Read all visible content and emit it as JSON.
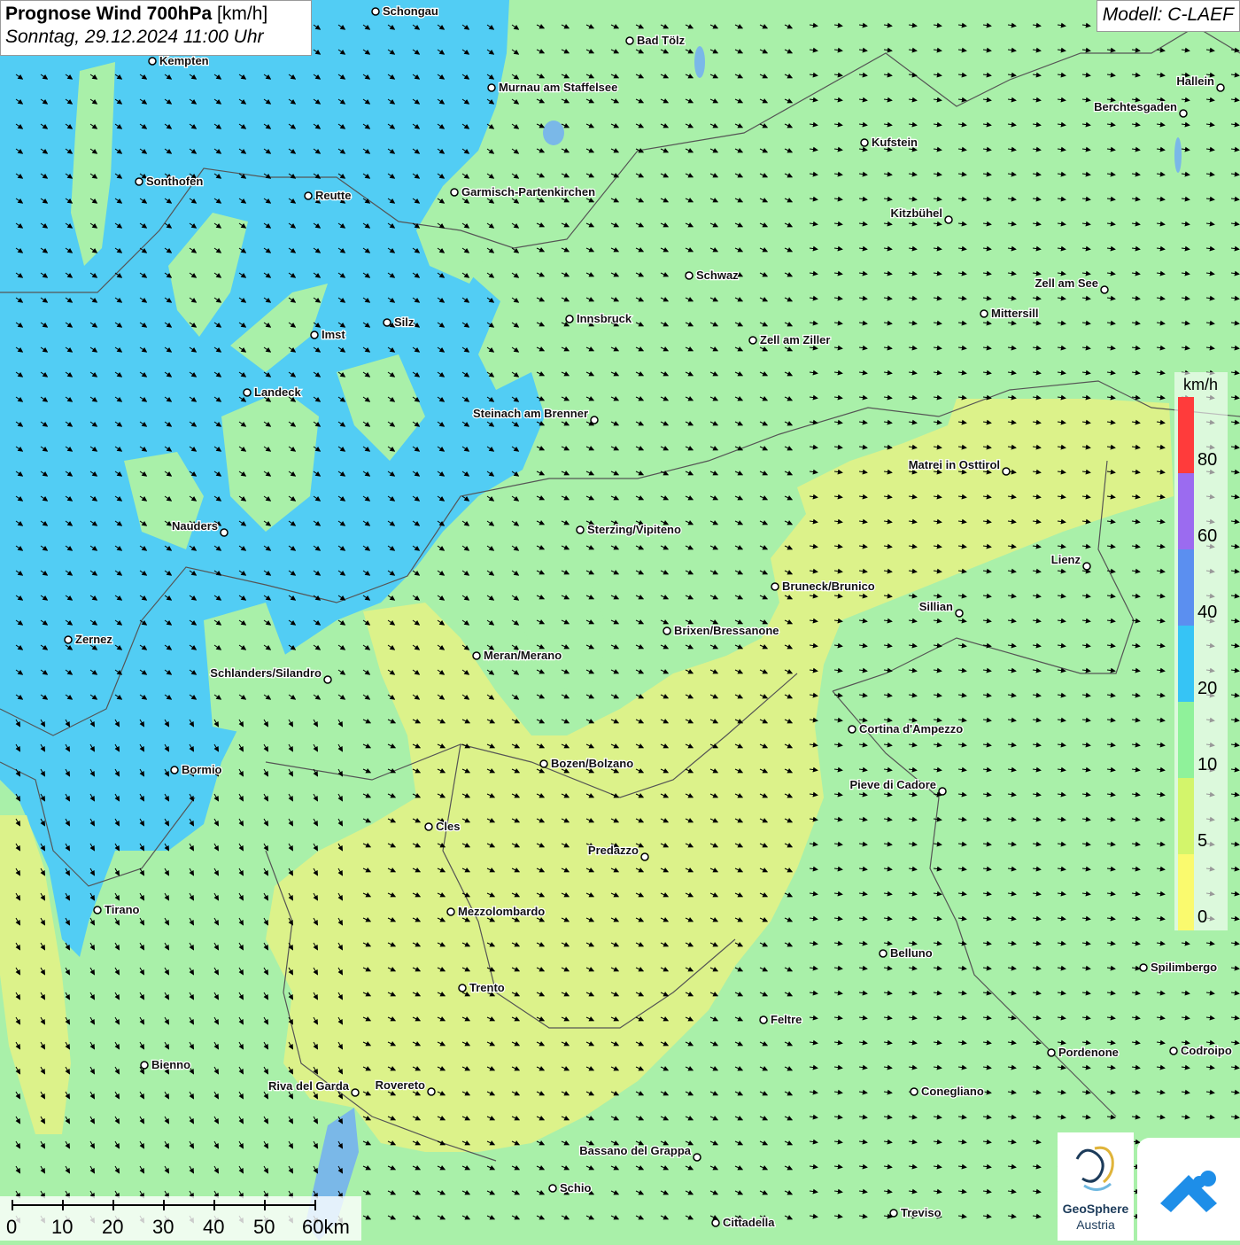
{
  "header": {
    "title_bold": "Prognose Wind 700hPa",
    "title_unit": "[km/h]",
    "subtitle": "Sonntag, 29.12.2024 11:00 Uhr"
  },
  "model_label": "Modell: C-LAEF",
  "legend": {
    "unit": "km/h",
    "labels": [
      "80",
      "60",
      "40",
      "20",
      "10",
      "5",
      "0"
    ],
    "colors": [
      "#ff3b3b",
      "#9b6bf0",
      "#5b8ff0",
      "#36c4f5",
      "#8ff29a",
      "#d3f56b",
      "#fafa6e"
    ]
  },
  "scale_bar": {
    "labels": [
      "0",
      "10",
      "20",
      "30",
      "40",
      "50",
      "60km"
    ]
  },
  "cities": [
    "Schongau",
    "Bad Tölz",
    "Kempten",
    "Murnau am Staffelsee",
    "Hallein",
    "Berchtesgaden",
    "Kufstein",
    "Sonthofen",
    "Reutte",
    "Garmisch-Partenkirchen",
    "Kitzbühel",
    "Schwaz",
    "Zell am See",
    "Mittersill",
    "Innsbruck",
    "Silz",
    "Imst",
    "Zell am Ziller",
    "Landeck",
    "Steinach am Brenner",
    "Matrei in Osttirol",
    "Nauders",
    "Sterzing/Vipiteno",
    "Lienz",
    "Bruneck/Brunico",
    "Sillian",
    "Brixen/Bressanone",
    "Zernez",
    "Meran/Merano",
    "Schlanders/Silandro",
    "Cortina d'Ampezzo",
    "Bozen/Bolzano",
    "Bormio",
    "Pieve di Cadore",
    "Cles",
    "Predazzo",
    "Tirano",
    "Mezzolombardo",
    "Belluno",
    "Spilimbergo",
    "Trento",
    "Feltre",
    "Pordenone",
    "Codroipo",
    "Bienno",
    "Riva del Garda",
    "Rovereto",
    "Conegliano",
    "Bassano del Grappa",
    "Schio",
    "Treviso",
    "Cittadella"
  ],
  "logos": {
    "geosphere_name": "GeoSphere",
    "geosphere_sub": "Austria"
  }
}
